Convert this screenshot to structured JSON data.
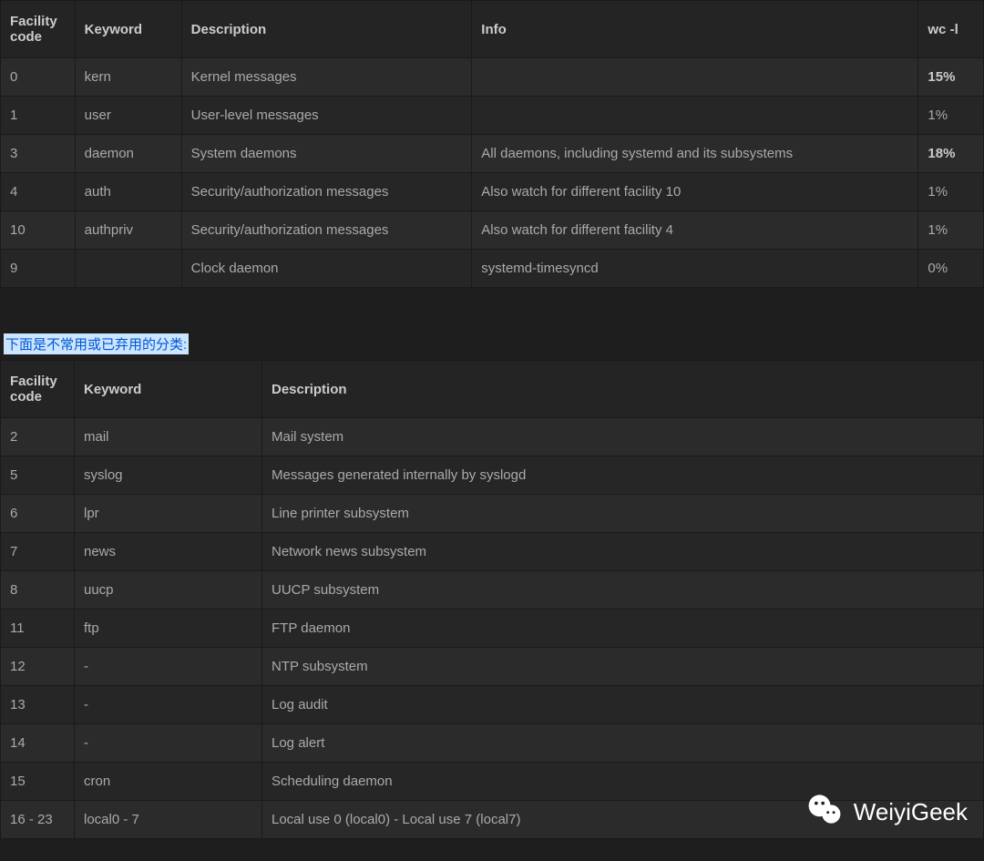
{
  "table1": {
    "headers": {
      "code": "Facility code",
      "keyword": "Keyword",
      "description": "Description",
      "info": "Info",
      "wc": "wc -l"
    },
    "rows": [
      {
        "code": "0",
        "keyword": "kern",
        "description": "Kernel messages",
        "info": "",
        "wc": "15%",
        "wc_bold": true
      },
      {
        "code": "1",
        "keyword": "user",
        "description": "User-level messages",
        "info": "",
        "wc": "1%",
        "wc_bold": false
      },
      {
        "code": "3",
        "keyword": "daemon",
        "description": "System daemons",
        "info": "All daemons, including systemd and its subsystems",
        "wc": "18%",
        "wc_bold": true
      },
      {
        "code": "4",
        "keyword": "auth",
        "description": "Security/authorization messages",
        "info": "Also watch for different facility 10",
        "wc": "1%",
        "wc_bold": false
      },
      {
        "code": "10",
        "keyword": "authpriv",
        "description": "Security/authorization messages",
        "info": "Also watch for different facility 4",
        "wc": "1%",
        "wc_bold": false
      },
      {
        "code": "9",
        "keyword": "",
        "description": "Clock daemon",
        "info": "systemd-timesyncd",
        "wc": "0%",
        "wc_bold": false
      }
    ]
  },
  "section_label": "下面是不常用或已弃用的分类:",
  "table2": {
    "headers": {
      "code": "Facility code",
      "keyword": "Keyword",
      "description": "Description"
    },
    "rows": [
      {
        "code": "2",
        "keyword": "mail",
        "description": "Mail system"
      },
      {
        "code": "5",
        "keyword": "syslog",
        "description": "Messages generated internally by syslogd"
      },
      {
        "code": "6",
        "keyword": "lpr",
        "description": "Line printer subsystem"
      },
      {
        "code": "7",
        "keyword": "news",
        "description": "Network news subsystem"
      },
      {
        "code": "8",
        "keyword": "uucp",
        "description": "UUCP subsystem"
      },
      {
        "code": "11",
        "keyword": "ftp",
        "description": "FTP daemon"
      },
      {
        "code": "12",
        "keyword": "-",
        "description": "NTP subsystem"
      },
      {
        "code": "13",
        "keyword": "-",
        "description": "Log audit"
      },
      {
        "code": "14",
        "keyword": "-",
        "description": "Log alert"
      },
      {
        "code": "15",
        "keyword": "cron",
        "description": "Scheduling daemon"
      },
      {
        "code": "16 - 23",
        "keyword": "local0 - 7",
        "description": "Local use 0 (local0) - Local use 7 (local7)"
      }
    ]
  },
  "watermark": {
    "text": "WeiyiGeek"
  }
}
